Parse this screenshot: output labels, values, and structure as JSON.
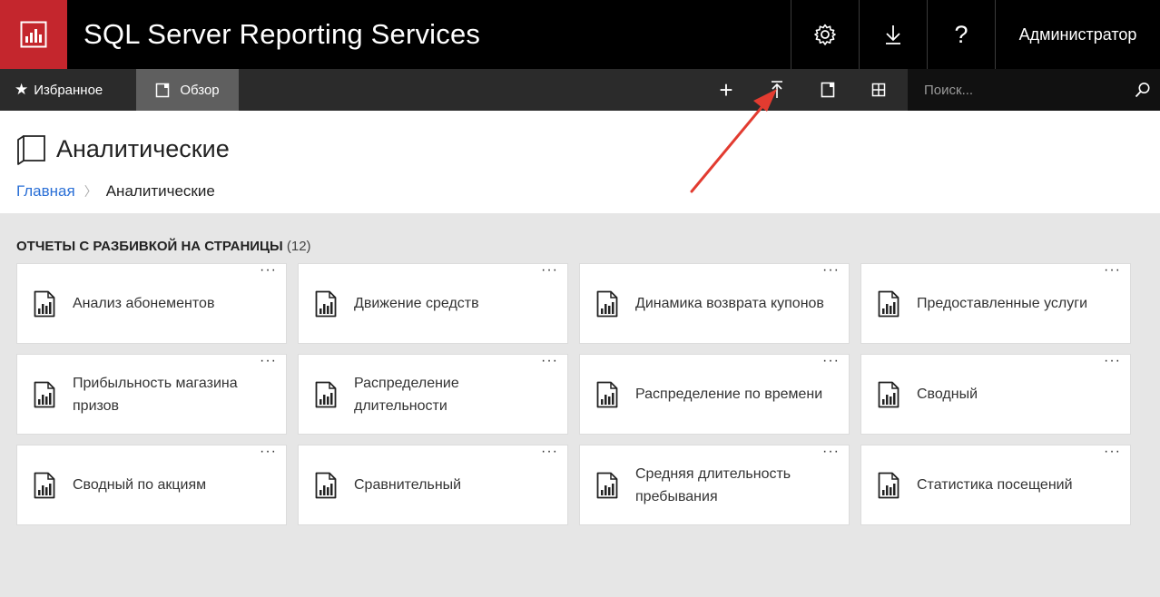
{
  "header": {
    "app_title": "SQL Server Reporting Services",
    "user": "Администратор",
    "buttons": [
      {
        "icon": "gear-icon",
        "glyph": "⚙"
      },
      {
        "icon": "download-icon",
        "glyph": "⤓"
      },
      {
        "icon": "help-icon",
        "glyph": "?"
      }
    ],
    "brand_color": "#c4262d"
  },
  "toolbar": {
    "favorites_label": "Избранное",
    "browse_label": "Обзор",
    "new_glyph": "+",
    "upload_glyph": "⤒",
    "search_placeholder": "Поиск..."
  },
  "page": {
    "title": "Аналитические",
    "breadcrumb": {
      "home": "Главная",
      "current": "Аналитические"
    }
  },
  "section": {
    "title": "ОТЧЕТЫ С РАЗБИВКОЙ НА СТРАНИЦЫ",
    "count": "(12)"
  },
  "reports": [
    "Анализ абонементов",
    "Движение средств",
    "Динамика возврата купонов",
    "Предоставленные услуги",
    "Прибыльность магазина призов",
    "Распределение длительности",
    "Распределение по времени",
    "Сводный",
    "Сводный по акциям",
    "Сравнительный",
    "Средняя длительность пребывания",
    "Статистика посещений"
  ],
  "tile_menu_glyph": "···"
}
